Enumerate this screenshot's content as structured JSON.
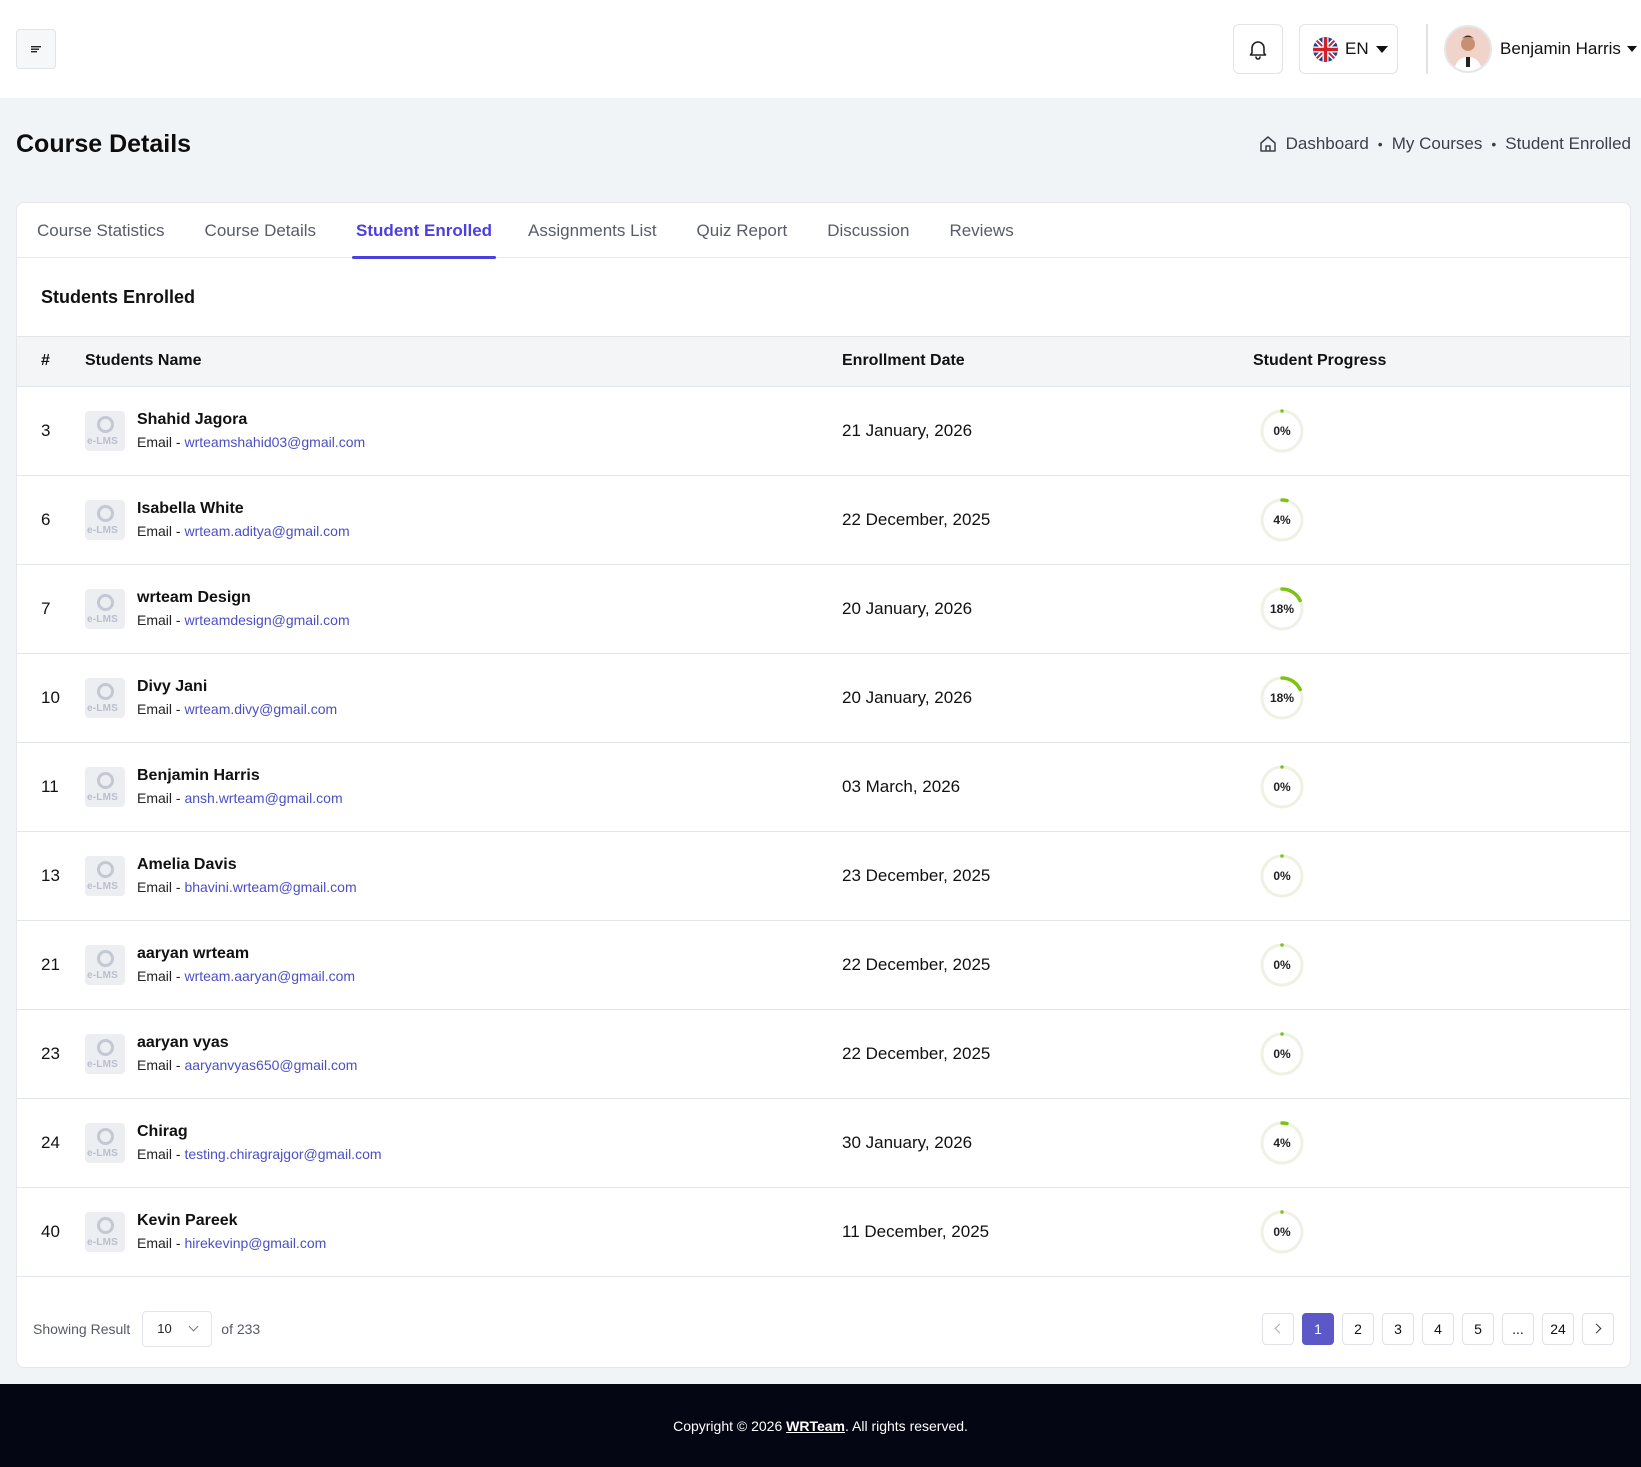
{
  "header": {
    "language": "EN",
    "user_name": "Benjamin Harris"
  },
  "page": {
    "title": "Course Details",
    "breadcrumb": [
      "Dashboard",
      "My Courses",
      "Student Enrolled"
    ]
  },
  "tabs": [
    {
      "label": "Course Statistics",
      "active": false
    },
    {
      "label": "Course Details",
      "active": false
    },
    {
      "label": "Student Enrolled",
      "active": true
    },
    {
      "label": "Assignments List",
      "active": false
    },
    {
      "label": "Quiz Report",
      "active": false
    },
    {
      "label": "Discussion",
      "active": false
    },
    {
      "label": "Reviews",
      "active": false
    }
  ],
  "section_title": "Students Enrolled",
  "table": {
    "columns": [
      "#",
      "Students Name",
      "Enrollment Date",
      "Student Progress"
    ],
    "email_prefix": "Email - ",
    "thumb_text": "e-LMS",
    "rows": [
      {
        "id": "3",
        "name": "Shahid Jagora",
        "email": "wrteamshahid03@gmail.com",
        "date": "21 January, 2026",
        "progress": 0,
        "progress_label": "0%"
      },
      {
        "id": "6",
        "name": "Isabella White",
        "email": "wrteam.aditya@gmail.com",
        "date": "22 December, 2025",
        "progress": 4,
        "progress_label": "4%"
      },
      {
        "id": "7",
        "name": "wrteam Design",
        "email": "wrteamdesign@gmail.com",
        "date": "20 January, 2026",
        "progress": 18,
        "progress_label": "18%"
      },
      {
        "id": "10",
        "name": "Divy Jani",
        "email": "wrteam.divy@gmail.com",
        "date": "20 January, 2026",
        "progress": 18,
        "progress_label": "18%"
      },
      {
        "id": "11",
        "name": "Benjamin Harris",
        "email": "ansh.wrteam@gmail.com",
        "date": "03 March, 2026",
        "progress": 0,
        "progress_label": "0%"
      },
      {
        "id": "13",
        "name": "Amelia Davis",
        "email": "bhavini.wrteam@gmail.com",
        "date": "23 December, 2025",
        "progress": 0,
        "progress_label": "0%"
      },
      {
        "id": "21",
        "name": "aaryan wrteam",
        "email": "wrteam.aaryan@gmail.com",
        "date": "22 December, 2025",
        "progress": 0,
        "progress_label": "0%"
      },
      {
        "id": "23",
        "name": "aaryan vyas",
        "email": "aaryanvyas650@gmail.com",
        "date": "22 December, 2025",
        "progress": 0,
        "progress_label": "0%"
      },
      {
        "id": "24",
        "name": "Chirag",
        "email": "testing.chiragrajgor@gmail.com",
        "date": "30 January, 2026",
        "progress": 4,
        "progress_label": "4%"
      },
      {
        "id": "40",
        "name": "Kevin Pareek",
        "email": "hirekevinp@gmail.com",
        "date": "11 December, 2025",
        "progress": 0,
        "progress_label": "0%"
      }
    ]
  },
  "pagination": {
    "showing_label": "Showing Result",
    "page_size": "10",
    "total_label": "of 233",
    "pages": [
      "1",
      "2",
      "3",
      "4",
      "5",
      "...",
      "24"
    ],
    "current": "1"
  },
  "footer": {
    "text_before": "Copyright © 2026 ",
    "brand": "WRTeam",
    "text_after": ". All rights reserved."
  },
  "colors": {
    "accent": "#4b3fe0",
    "progress": "#7cc314",
    "progress_track": "#eef2e4",
    "footer_bg": "#050614"
  }
}
